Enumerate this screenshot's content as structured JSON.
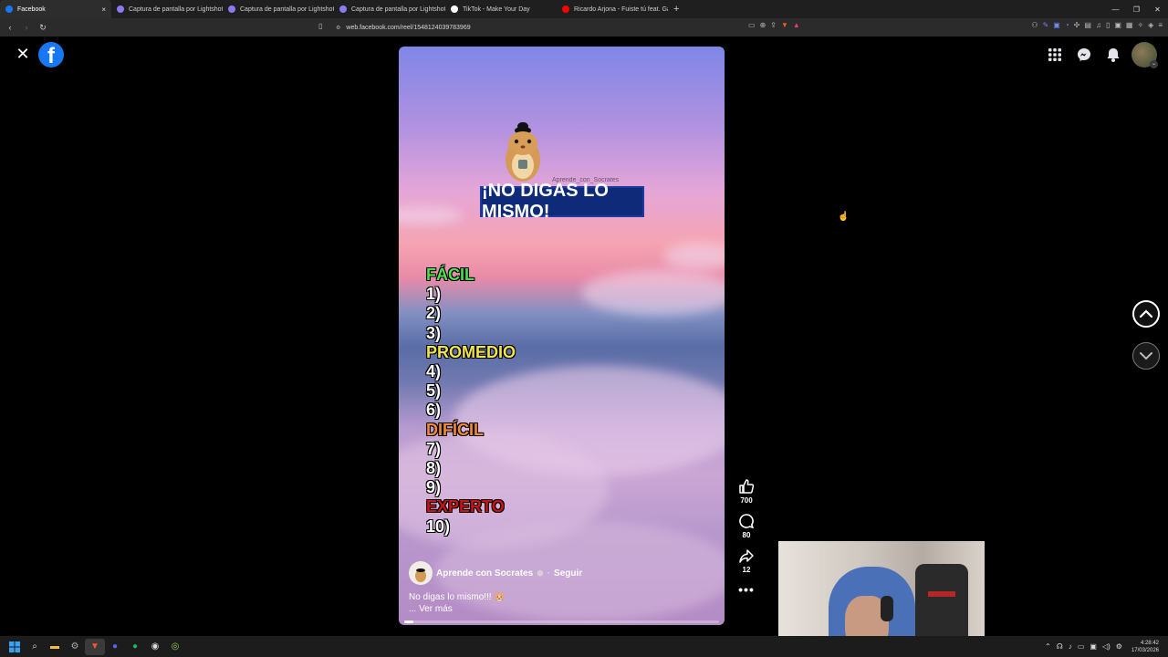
{
  "browser": {
    "tabs": [
      {
        "label": "Facebook",
        "icon": "facebook-icon",
        "color": "#1877f2",
        "active": true
      },
      {
        "label": "Captura de pantalla por Lightshot",
        "icon": "feather-icon",
        "color": "#8a7cf0"
      },
      {
        "label": "Captura de pantalla por Lightshot",
        "icon": "feather-icon",
        "color": "#8a7cf0"
      },
      {
        "label": "Captura de pantalla por Lightshot",
        "icon": "feather-icon",
        "color": "#8a7cf0"
      },
      {
        "label": "TikTok - Make Your Day",
        "icon": "tiktok-icon",
        "color": "#ffffff"
      },
      {
        "label": "Ricardo Arjona - Fuiste tú feat. Gaby",
        "icon": "youtube-icon",
        "color": "#ff0000"
      }
    ],
    "url": "web.facebook.com/reel/1548124039783969",
    "brave_color": "#fb542b"
  },
  "reel": {
    "watermark": "Aprende_con_Socrates",
    "banner": "¡NO DIGAS LO MISMO!",
    "list": [
      {
        "text": "FÁCIL",
        "cls": "green"
      },
      {
        "text": "1)",
        "cls": ""
      },
      {
        "text": "2)",
        "cls": ""
      },
      {
        "text": "3)",
        "cls": ""
      },
      {
        "text": "PROMEDIO",
        "cls": "yellow"
      },
      {
        "text": "4)",
        "cls": ""
      },
      {
        "text": "5)",
        "cls": ""
      },
      {
        "text": "6)",
        "cls": ""
      },
      {
        "text": "DIFÍCIL",
        "cls": "orange"
      },
      {
        "text": "7)",
        "cls": ""
      },
      {
        "text": "8)",
        "cls": ""
      },
      {
        "text": "9)",
        "cls": ""
      },
      {
        "text": "EXPERTO",
        "cls": "red"
      },
      {
        "text": "10)",
        "cls": ""
      }
    ],
    "author": "Aprende con Socrates",
    "follow": "Seguir",
    "caption": "No digas lo mismo!!! 🐹",
    "see_more": "... Ver más",
    "progress": 0.03
  },
  "actions": {
    "likes": "700",
    "comments": "80",
    "shares": "12"
  },
  "system": {
    "time": "4:28:42",
    "date": "17/03/2026"
  }
}
